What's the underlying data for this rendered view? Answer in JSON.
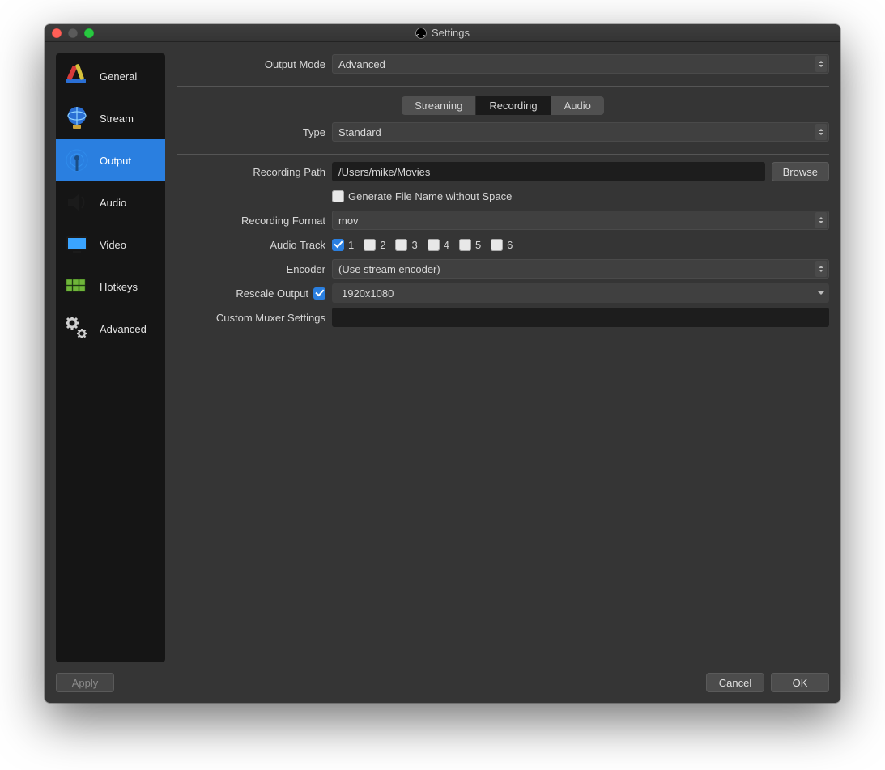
{
  "window": {
    "title": "Settings"
  },
  "sidebar": {
    "items": [
      {
        "label": "General"
      },
      {
        "label": "Stream"
      },
      {
        "label": "Output"
      },
      {
        "label": "Audio"
      },
      {
        "label": "Video"
      },
      {
        "label": "Hotkeys"
      },
      {
        "label": "Advanced"
      }
    ]
  },
  "output_mode": {
    "label": "Output Mode",
    "value": "Advanced"
  },
  "tabs": {
    "streaming": "Streaming",
    "recording": "Recording",
    "audio": "Audio"
  },
  "type": {
    "label": "Type",
    "value": "Standard"
  },
  "path": {
    "label": "Recording Path",
    "value": "/Users/mike/Movies",
    "browse": "Browse"
  },
  "gen_no_space": {
    "label": "Generate File Name without Space",
    "checked": false
  },
  "format": {
    "label": "Recording Format",
    "value": "mov"
  },
  "audio_track": {
    "label": "Audio Track",
    "tracks": [
      {
        "n": "1",
        "checked": true
      },
      {
        "n": "2",
        "checked": false
      },
      {
        "n": "3",
        "checked": false
      },
      {
        "n": "4",
        "checked": false
      },
      {
        "n": "5",
        "checked": false
      },
      {
        "n": "6",
        "checked": false
      }
    ]
  },
  "encoder": {
    "label": "Encoder",
    "value": "(Use stream encoder)"
  },
  "rescale": {
    "label": "Rescale Output",
    "checked": true,
    "value": "1920x1080"
  },
  "muxer": {
    "label": "Custom Muxer Settings",
    "value": ""
  },
  "footer": {
    "apply": "Apply",
    "cancel": "Cancel",
    "ok": "OK"
  }
}
